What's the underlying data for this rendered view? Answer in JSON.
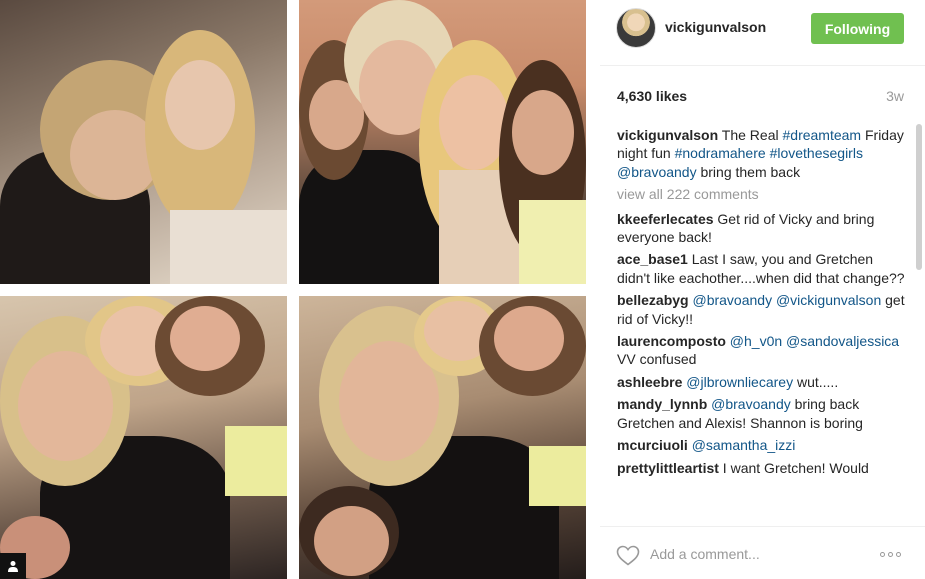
{
  "post": {
    "username": "vickigunvalson",
    "follow_label": "Following",
    "likes": "4,630 likes",
    "age": "3w",
    "caption": {
      "user": "vickigunvalson",
      "text_1": " The Real ",
      "tag_1": "#dreamteam",
      "text_2": " Friday night fun ",
      "tag_2": "#nodramahere",
      "tag_3": "#lovethesegirls",
      "text_3": " ",
      "mention": "@bravoandy",
      "text_4": " bring them back"
    },
    "view_all": "view all 222 comments",
    "comments": [
      {
        "user": "kkeeferlecates",
        "text": " Get rid of Vicky and bring everyone back!"
      },
      {
        "user": "ace_base1",
        "text": " Last I saw, you and Gretchen didn't like eachother....when did that change??"
      },
      {
        "user": "bellezabyg",
        "m1": "@bravoandy",
        "m2": "@vickigunvalson",
        "text": " get rid of Vicky!!"
      },
      {
        "user": "laurencomposto",
        "m1": "@h_v0n",
        "m2": "@sandovaljessica",
        "text": " VV confused"
      },
      {
        "user": "ashleebre",
        "m1": "@jlbrownliecarey",
        "text": " wut....."
      },
      {
        "user": "mandy_lynnb",
        "m1": "@bravoandy",
        "text": " bring back Gretchen and Alexis! Shannon is boring"
      },
      {
        "user": "mcurciuoli",
        "m1": "@samantha_izzi",
        "text": ""
      },
      {
        "user": "prettylittleartist",
        "text": " I want Gretchen! Would"
      }
    ],
    "add_comment_placeholder": "Add a comment..."
  },
  "colors": {
    "follow_green": "#70c050",
    "link_blue": "#125688",
    "muted": "#999999"
  },
  "icons": {
    "heart": "heart-outline-icon",
    "more": "ellipsis-icon",
    "user_tag": "person-icon"
  }
}
